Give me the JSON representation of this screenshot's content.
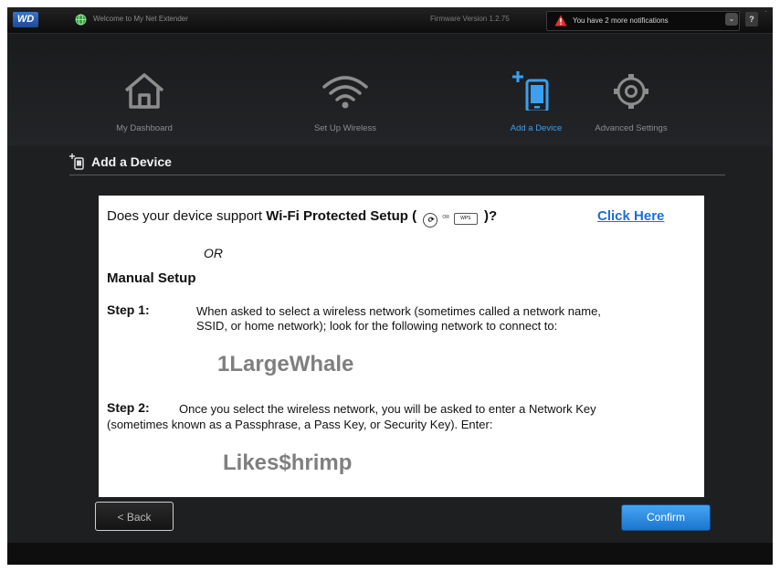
{
  "header": {
    "logo_text": "WD",
    "welcome_text": "Welcome to My Net Extender",
    "firmware_text": "Firmware Version 1.2.75",
    "notification_text": "You have 2 more notifications",
    "help_label": "?"
  },
  "nav": {
    "items": [
      {
        "label": "My Dashboard",
        "icon": "home-icon"
      },
      {
        "label": "Set Up Wireless",
        "icon": "wifi-icon"
      },
      {
        "label": "Add a Device",
        "icon": "add-device-icon",
        "active": true
      },
      {
        "label": "Advanced Settings",
        "icon": "gear-icon"
      }
    ]
  },
  "section": {
    "title": "Add a Device"
  },
  "content": {
    "question_prefix": "Does your device support ",
    "question_bold": "Wi-Fi Protected Setup (",
    "question_or_small": "OR",
    "wps_button_text": "WPS",
    "question_suffix": ")?",
    "click_here": "Click Here",
    "or_text": "OR",
    "manual_title": "Manual Setup",
    "step1_label": "Step 1:",
    "step1_line1": "When asked to select a wireless network (sometimes called a network name,",
    "step1_line2": "SSID, or home network); look for the following network to connect to:",
    "network_name": "1LargeWhale",
    "step2_label": "Step 2:",
    "step2_line1": "Once you select the wireless network, you will be asked to enter a Network Key",
    "step2_line2": "(sometimes known as a Passphrase, a Pass Key, or Security Key). Enter:",
    "network_key": "Likes$hrimp"
  },
  "buttons": {
    "back_label": "< Back",
    "confirm_label": "Confirm"
  },
  "colors": {
    "accent": "#3aa0ef",
    "link": "#1a6fd6",
    "confirm": "#2a8ae0"
  }
}
